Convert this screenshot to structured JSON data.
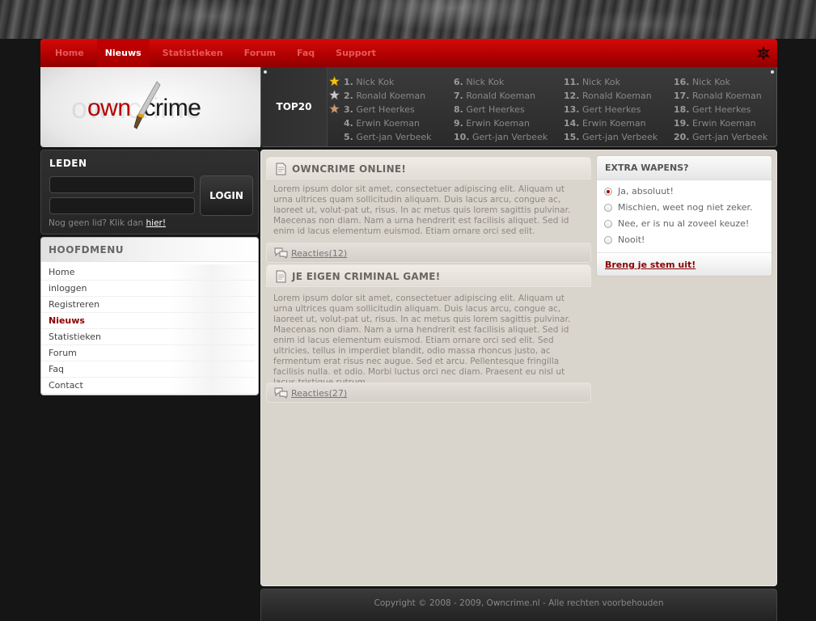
{
  "nav": {
    "items": [
      {
        "label": "Home",
        "active": false
      },
      {
        "label": "Nieuws",
        "active": true
      },
      {
        "label": "Statistieken",
        "active": false
      },
      {
        "label": "Forum",
        "active": false
      },
      {
        "label": "Faq",
        "active": false
      },
      {
        "label": "Support",
        "active": false
      }
    ],
    "icon": "settings-icon"
  },
  "logo": {
    "part1": "own",
    "part2": "crime",
    "ghost": "owncrime"
  },
  "top20": {
    "label": "TOP20",
    "columns": [
      [
        {
          "num": "1.",
          "name": "Nick Kok",
          "medal": "gold"
        },
        {
          "num": "2.",
          "name": "Ronald Koeman",
          "medal": "silver"
        },
        {
          "num": "3.",
          "name": "Gert Heerkes",
          "medal": "bronze"
        },
        {
          "num": "4.",
          "name": "Erwin Koeman",
          "medal": ""
        },
        {
          "num": "5.",
          "name": "Gert-jan Verbeek",
          "medal": ""
        }
      ],
      [
        {
          "num": "6.",
          "name": "Nick Kok"
        },
        {
          "num": "7.",
          "name": "Ronald Koeman"
        },
        {
          "num": "8.",
          "name": "Gert Heerkes"
        },
        {
          "num": "9.",
          "name": "Erwin Koeman"
        },
        {
          "num": "10.",
          "name": "Gert-jan Verbeek"
        }
      ],
      [
        {
          "num": "11.",
          "name": "Nick Kok"
        },
        {
          "num": "12.",
          "name": "Ronald Koeman"
        },
        {
          "num": "13.",
          "name": "Gert Heerkes"
        },
        {
          "num": "14.",
          "name": "Erwin Koeman"
        },
        {
          "num": "15.",
          "name": "Gert-jan Verbeek"
        }
      ],
      [
        {
          "num": "16.",
          "name": "Nick Kok"
        },
        {
          "num": "17.",
          "name": "Ronald Koeman"
        },
        {
          "num": "18.",
          "name": "Gert Heerkes"
        },
        {
          "num": "19.",
          "name": "Erwin Koeman"
        },
        {
          "num": "20.",
          "name": "Gert-jan Verbeek"
        }
      ]
    ]
  },
  "leden": {
    "title": "LEDEN",
    "username_value": "",
    "password_value": "",
    "login_label": "LOGIN",
    "register_text": "Nog geen lid? Klik dan ",
    "register_link": "hier!"
  },
  "hoofdmenu": {
    "title": "HOOFDMENU",
    "items": [
      {
        "label": "Home",
        "active": false
      },
      {
        "label": "inloggen",
        "active": false
      },
      {
        "label": "Registreren",
        "active": false
      },
      {
        "label": "Nieuws",
        "active": true
      },
      {
        "label": "Statistieken",
        "active": false
      },
      {
        "label": "Forum",
        "active": false
      },
      {
        "label": "Faq",
        "active": false
      },
      {
        "label": "Contact",
        "active": false
      }
    ]
  },
  "news": [
    {
      "title": "OWNCRIME ONLINE!",
      "body": "Lorem ipsum dolor sit amet, consectetuer adipiscing elit. Aliquam ut urna ultrices quam sollicitudin aliquam. Duis lacus arcu, congue ac, laoreet ut, volut-pat ut, risus. In ac metus quis lorem sagittis pulvinar. Maecenas non diam. Nam a urna hendrerit est facilisis aliquet. Sed id enim id lacus elementum euismod. Etiam ornare orci sed elit.",
      "reactions": "Reacties(12)"
    },
    {
      "title": "JE EIGEN CRIMINAL GAME!",
      "body": "Lorem ipsum dolor sit amet, consectetuer adipiscing elit. Aliquam ut urna ultrices quam sollicitudin aliquam. Duis lacus arcu, congue ac, laoreet ut, volut-pat ut, risus. In ac metus quis lorem sagittis pulvinar. Maecenas non diam. Nam a urna hendrerit est facilisis aliquet. Sed id enim id lacus elementum euismod. Etiam ornare orci sed elit. Sed ultricies, tellus in imperdiet blandit, odio massa rhoncus justo, ac fermentum erat risus nec augue. Sed et arcu. Pellentesque fringilla facilisis nulla. et odio. Morbi luctus orci nec diam. Praesent eu nisl ut lacus tristique rutrum.",
      "reactions": "Reacties(27)"
    }
  ],
  "poll": {
    "title": "EXTRA WAPENS?",
    "options": [
      {
        "label": "Ja, absoluut!",
        "selected": true
      },
      {
        "label": "Mischien, weet nog niet zeker.",
        "selected": false
      },
      {
        "label": "Nee, er is nu  al zoveel keuze!",
        "selected": false
      },
      {
        "label": "Nooit!",
        "selected": false
      }
    ],
    "submit": "Breng je stem uit!"
  },
  "footer": {
    "text": "Copyright © 2008 - 2009, Owncrime.nl - Alle rechten voorbehouden"
  },
  "colors": {
    "brand_red": "#b30000",
    "active_link": "#8b0000"
  }
}
